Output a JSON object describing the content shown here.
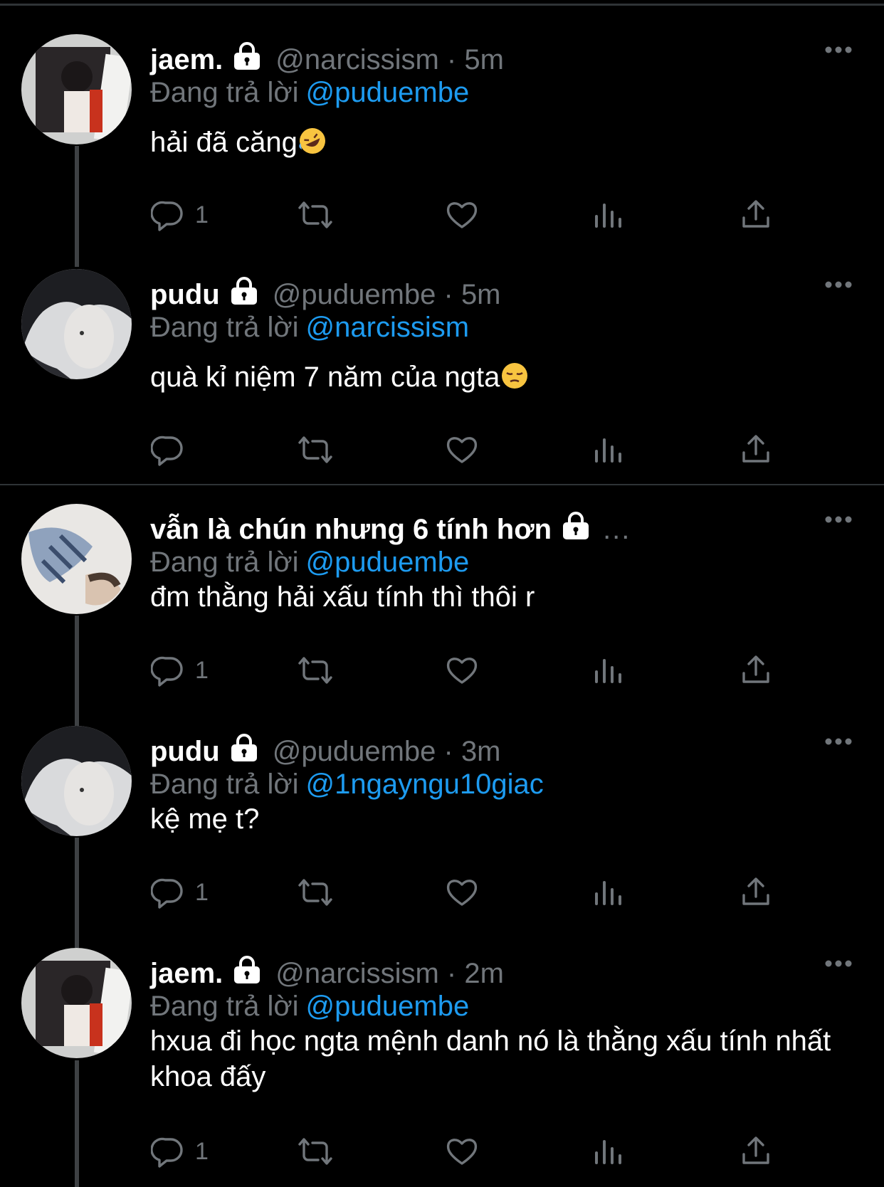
{
  "theme": {
    "background": "#000000",
    "muted": "#71767b",
    "link": "#1d9bf0",
    "text": "#e7e9ea"
  },
  "tweets": [
    {
      "name": "jaem.",
      "handle": "@narcissism",
      "time": "5m",
      "reply_label": "Đang trả lời",
      "reply_to": "@puduembe",
      "text": "hải đã căng",
      "emoji": "rolling-on-floor-laughing-emoji",
      "reply_count": "1",
      "avatar": "avatar-jaem"
    },
    {
      "name": "pudu",
      "handle": "@puduembe",
      "time": "5m",
      "reply_label": "Đang trả lời",
      "reply_to": "@narcissism",
      "text": "quà kỉ niệm 7 năm của ngta",
      "emoji": "pensive-face-emoji",
      "reply_count": "",
      "avatar": "avatar-pudu"
    },
    {
      "name": "vẫn là chún nhưng 6 tính hơn",
      "handle": "...",
      "time": "",
      "reply_label": "Đang trả lời",
      "reply_to": "@puduembe",
      "text": "đm thằng hải xấu tính thì thôi r",
      "reply_count": "1",
      "avatar": "avatar-chun"
    },
    {
      "name": "pudu",
      "handle": "@puduembe",
      "time": "3m",
      "reply_label": "Đang trả lời",
      "reply_to": "@1ngayngu10giac",
      "text": "kệ mẹ t?",
      "reply_count": "1",
      "avatar": "avatar-pudu"
    },
    {
      "name": "jaem.",
      "handle": "@narcissism",
      "time": "2m",
      "reply_label": "Đang trả lời",
      "reply_to": "@puduembe",
      "text": "hxua đi học ngta mệnh danh nó là thằng xấu tính nhất khoa đấy",
      "reply_count": "1",
      "avatar": "avatar-jaem"
    }
  ],
  "icons": {
    "reply": "reply-icon",
    "retweet": "retweet-icon",
    "like": "heart-icon",
    "views": "views-chart-icon",
    "share": "share-icon",
    "lock": "lock-icon",
    "more": "more-icon"
  }
}
